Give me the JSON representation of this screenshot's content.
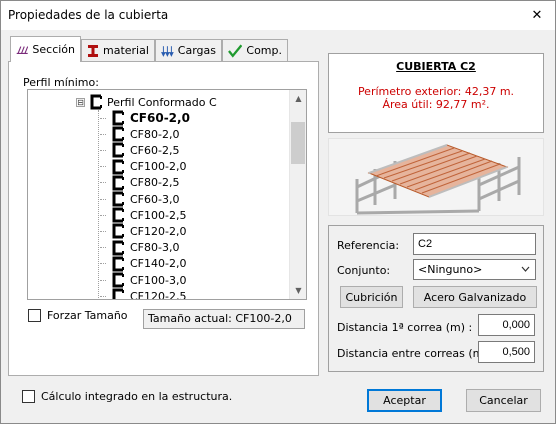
{
  "window": {
    "title": "Propiedades de la cubierta",
    "close_glyph": "✕"
  },
  "tabs": [
    {
      "label": "Sección",
      "icon": "purlin-section-icon"
    },
    {
      "label": "material",
      "icon": "i-beam-icon"
    },
    {
      "label": "Cargas",
      "icon": "loads-arrows-icon"
    },
    {
      "label": "Comp.",
      "icon": "checkmark-icon"
    }
  ],
  "seccion": {
    "group_label": "Perfil mínimo:",
    "tree_root": {
      "expander": "⊟",
      "label": "Perfil Conformado C"
    },
    "items": [
      "CF60-2,0",
      "CF80-2,0",
      "CF60-2,5",
      "CF100-2,0",
      "CF80-2,5",
      "CF60-3,0",
      "CF100-2,5",
      "CF120-2,0",
      "CF80-3,0",
      "CF140-2,0",
      "CF100-3,0",
      "CF120-2,5"
    ],
    "selected_index": 0,
    "scroll_up": "▲",
    "scroll_down": "▼",
    "force_size_label": "Forzar Tamaño",
    "force_size_checked": false,
    "current_size_text": "Tamaño actual: CF100-2,0"
  },
  "summary": {
    "title": "CUBIERTA C2",
    "perimeter_text": "Perímetro exterior: 42,37 m.",
    "area_text": "Área útil: 92,77 m².",
    "text_color": "#cc0000"
  },
  "form": {
    "referencia_label": "Referencia:",
    "referencia_value": "C2",
    "conjunto_label": "Conjunto:",
    "conjunto_value": "<Ninguno>",
    "cubricion_button": "Cubrición",
    "material_button": "Acero Galvanizado",
    "distancia1_label": "Distancia 1ª correa (m) :",
    "distancia1_value": "0,000",
    "distancia2_label": "Distancia entre correas (m.)",
    "distancia2_value": "0,500"
  },
  "footer": {
    "integrated_label": "Cálculo integrado en la estructura.",
    "integrated_checked": false,
    "accept_button": "Aceptar",
    "cancel_button": "Cancelar",
    "accent": "#0078d7"
  }
}
